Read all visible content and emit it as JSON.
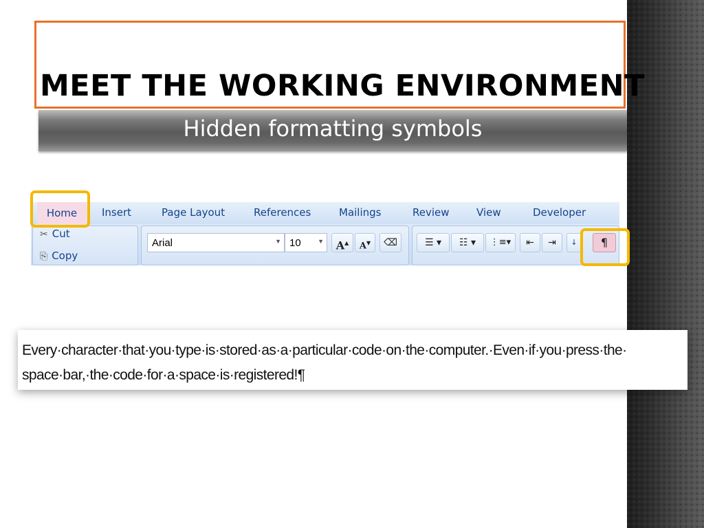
{
  "slide": {
    "title": "MEET THE WORKING ENVIRONMENT",
    "subtitle": "Hidden formatting symbols"
  },
  "ribbon": {
    "tabs": [
      "Home",
      "Insert",
      "Page Layout",
      "References",
      "Mailings",
      "Review",
      "View",
      "Developer"
    ],
    "active_tab": "Home",
    "clipboard": {
      "cut_label": "Cut",
      "copy_label": "Copy"
    },
    "font": {
      "name": "Arial",
      "size": "10",
      "grow_label": "A",
      "shrink_label": "A"
    },
    "show_hide_symbol": "¶"
  },
  "example": {
    "line1": "Every·character·that·you·type·is·stored·as·a·particular·code·on·the·computer.·Even·if·you·press·the·",
    "line2": "space·bar,·the·code·for·a·space·is·registered!¶"
  },
  "colors": {
    "title_border": "#e8702a",
    "highlight": "#f5b800",
    "ribbon_text": "#15428b"
  }
}
